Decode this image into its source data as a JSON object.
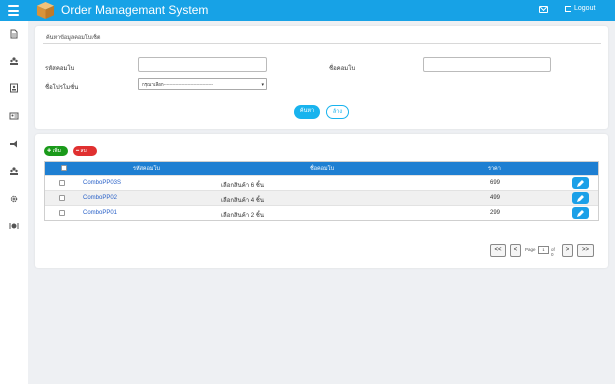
{
  "app": {
    "title": "Order Managemant System",
    "logout_label": "Logout"
  },
  "colors": {
    "topbar": "#17a2e6",
    "header_row": "#1e7fd2",
    "add": "#1a9a1a",
    "delete": "#e03030",
    "edit": "#1ba0e8"
  },
  "sidebar": {
    "items": [
      {
        "icon": "document-icon"
      },
      {
        "icon": "users-icon"
      },
      {
        "icon": "address-book-icon"
      },
      {
        "icon": "contact-card-icon"
      },
      {
        "icon": "megaphone-icon"
      },
      {
        "icon": "users-group-icon"
      },
      {
        "icon": "settings-icon"
      },
      {
        "icon": "dining-icon"
      }
    ]
  },
  "search": {
    "title": "ค้นหาข้อมูลคอมโบเซ็ต",
    "code_label": "รหัสคอมโบ",
    "code_value": "",
    "name_label": "ชื่อคอมโบ",
    "name_value": "",
    "promo_label": "ชื่อโปรโมชั่น",
    "promo_selected": "กรุณาเลือก---------------------------------",
    "search_button": "ค้นหา",
    "clear_button": "ล้าง"
  },
  "list": {
    "add_button": "เพิ่ม",
    "delete_button": "ลบ",
    "columns": [
      "รหัสคอมโบ",
      "ชื่อคอมโบ",
      "ราคา"
    ],
    "rows": [
      {
        "code": "ComboPP03S",
        "name": "เลือกสินค้า 6 ชิ้น",
        "price": "699"
      },
      {
        "code": "ComboPP02",
        "name": "เลือกสินค้า 4 ชิ้น",
        "price": "499"
      },
      {
        "code": "ComboPP01",
        "name": "เลือกสินค้า 2 ชิ้น",
        "price": "299"
      }
    ]
  },
  "pager": {
    "first": "<<",
    "prev": "<",
    "page_label": "Page",
    "page_value": "1",
    "of_label": "of 0",
    "next": ">",
    "last": ">>"
  }
}
